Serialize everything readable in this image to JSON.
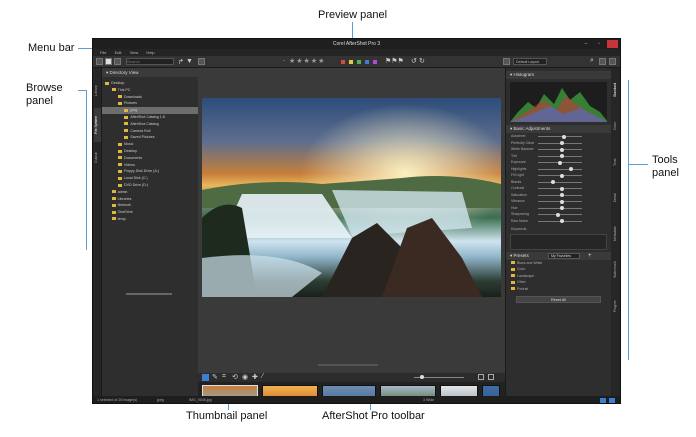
{
  "annotations": {
    "preview_panel": "Preview panel",
    "menu_bar": "Menu bar",
    "browse_panel": "Browse\npanel",
    "tools_panel": "Tools\npanel",
    "thumbnail_panel": "Thumbnail panel",
    "aftershot_toolbar": "AfterShot Pro toolbar"
  },
  "app": {
    "title": "Corel AfterShot Pro 3",
    "menu": [
      "File",
      "Edit",
      "View",
      "Help"
    ],
    "toolbar": {
      "search_placeholder": "Search",
      "rating_prefix": "-",
      "rating_stars": "★★★★★",
      "label_colors": [
        "#d24a4a",
        "#e6c640",
        "#4fb34f",
        "#4a78d2",
        "#b04ad2"
      ],
      "layout_select": "Default Layout"
    },
    "side_tabs": [
      "Library",
      "File System",
      "Output"
    ],
    "browse": {
      "title": "Directory View",
      "tree": [
        "Desktop",
        "This PC",
        "Downloads",
        "Pictures",
        "jpeg",
        "AfterShot Catalog 1.8",
        "AfterShot Catalog",
        "Camera Roll",
        "Saved Pictures",
        "Music",
        "Desktop",
        "Documents",
        "Videos",
        "Floppy Disk Drive (A:)",
        "Local Disk (C:)",
        "DVD Drive (D:)",
        "admin",
        "Libraries",
        "Network",
        "OneDrive",
        "temp"
      ],
      "selected_index": 4
    },
    "tools": {
      "histogram": "Histogram",
      "basic": "Basic Adjustments",
      "sliders": [
        "Autolevel",
        "Perfectly Clear",
        "White Balance",
        "Tint",
        "Exposure",
        "Highlights",
        "Fill Light",
        "Blacks",
        "Contrast",
        "Saturation",
        "Vibrance",
        "Hue",
        "Sharpening",
        "Raw Noise"
      ],
      "keywords": "Keywords",
      "presets": "Presets",
      "preset_select": "My Favorites",
      "preset_list": [
        "Black and White",
        "Color",
        "Landscape",
        "Other",
        "Portrait"
      ],
      "reset": "Reset All"
    },
    "right_tabs": [
      "Standard",
      "Color",
      "Tone",
      "Detail",
      "Metadata",
      "Watermark",
      "Plugins"
    ],
    "status": {
      "left": "1 selected of 25 image(s)",
      "folder": "jpeg",
      "file": "IMG_0045.jpg",
      "right": "3 Wide"
    }
  }
}
